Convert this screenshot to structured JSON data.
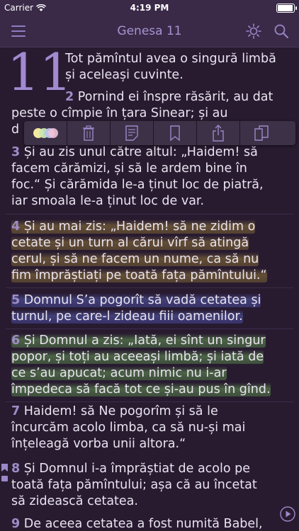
{
  "status": {
    "carrier": "Carrier",
    "time": "4:19 PM",
    "battery_level": 0.95
  },
  "nav": {
    "title": "Genesa 11",
    "menu_icon": "menu-icon",
    "brightness_icon": "brightness-icon",
    "search_icon": "search-icon"
  },
  "chapter": {
    "number": "11"
  },
  "verses": [
    {
      "num": "",
      "lines": [
        "Tot pămîntul avea o singură limbă",
        "și aceleași cuvinte."
      ]
    },
    {
      "num": "2",
      "lines": [
        "Pornind ei înspre răsărit, au dat",
        "peste o cîmpie în țara Sinear; și au",
        "d"
      ]
    },
    {
      "num": "3",
      "lines": [
        "Și au zis unul către altul: „Haidem! să",
        "facem cărămizi, și să le ardem bine în",
        "foc.“ Și cărămida le-a ținut loc de piatră,",
        "iar smoala le-a ținut loc de var."
      ]
    },
    {
      "num": "4",
      "lines": [
        "Și au mai zis: „Haidem! să ne zidim o",
        "cetate și un turn al cărui vîrf să atingă",
        "cerul, și să ne facem un nume, ca să nu",
        "fim împrăștiați pe toată fața pămîntului.“"
      ]
    },
    {
      "num": "5",
      "lines": [
        "Domnul S’a pogorît să vadă cetatea și",
        "turnul, pe care-l zideau fiii oamenilor."
      ]
    },
    {
      "num": "6",
      "lines": [
        "Și Domnul a zis: „Iată, ei sînt un singur",
        "popor, și toți au aceeași limbă; și iată de",
        "ce s’au apucat; acum nimic nu i-ar",
        "împedeca să facă tot ce și-au pus în gînd."
      ]
    },
    {
      "num": "7",
      "lines": [
        "Haidem! să Ne pogorîm și să le",
        "încurcăm acolo limba, ca să nu-și mai",
        "înțeleagă vorba unii altora.“"
      ]
    },
    {
      "num": "8",
      "lines": [
        "Și Domnul i-a împrăștiat de acolo pe",
        "toată fața pămîntului; așa că au încetat",
        "să zidească cetatea."
      ]
    },
    {
      "num": "9",
      "lines": [
        "De aceea cetatea a fost numită Babel,"
      ]
    }
  ],
  "toolbar": {
    "items": [
      {
        "name": "highlight-color-button",
        "icon": "color-dots-icon"
      },
      {
        "name": "delete-button",
        "icon": "trash-icon"
      },
      {
        "name": "note-button",
        "icon": "note-icon"
      },
      {
        "name": "bookmark-button",
        "icon": "bookmark-icon"
      },
      {
        "name": "share-button",
        "icon": "share-icon"
      },
      {
        "name": "copy-button",
        "icon": "copy-icon"
      }
    ]
  },
  "colors": {
    "background": "#281b30",
    "navbar": "#3a2a48",
    "accent": "#a694d0",
    "highlight_gold": "#a88c3c",
    "highlight_blue": "#5a64be",
    "highlight_green": "#6eaa5a"
  }
}
